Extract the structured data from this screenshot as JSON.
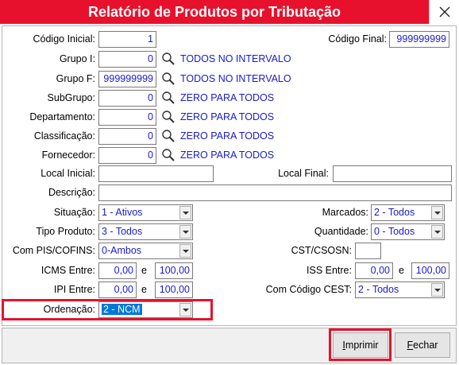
{
  "window": {
    "title": "Relatório de Produtos por Tributação",
    "close_icon": "close-icon"
  },
  "fields": {
    "codigo_inicial": {
      "label": "Código Inicial:",
      "value": "1"
    },
    "codigo_final": {
      "label": "Código Final:",
      "value": "999999999"
    },
    "grupo_i": {
      "label": "Grupo I:",
      "value": "0",
      "hint": "TODOS NO INTERVALO"
    },
    "grupo_f": {
      "label": "Grupo F:",
      "value": "999999999",
      "hint": "TODOS NO INTERVALO"
    },
    "subgrupo": {
      "label": "SubGrupo:",
      "value": "0",
      "hint": "ZERO PARA TODOS"
    },
    "departamento": {
      "label": "Departamento:",
      "value": "0",
      "hint": "ZERO PARA TODOS"
    },
    "classificacao": {
      "label": "Classificação:",
      "value": "0",
      "hint": "ZERO PARA TODOS"
    },
    "fornecedor": {
      "label": "Fornecedor:",
      "value": "0",
      "hint": "ZERO PARA TODOS"
    },
    "local_inicial": {
      "label": "Local Inicial:",
      "value": ""
    },
    "local_final": {
      "label": "Local Final:",
      "value": ""
    },
    "descricao": {
      "label": "Descrição:",
      "value": ""
    },
    "situacao": {
      "label": "Situação:",
      "value": "1 - Ativos"
    },
    "marcados": {
      "label": "Marcados:",
      "value": "2 - Todos"
    },
    "tipo_produto": {
      "label": "Tipo Produto:",
      "value": "3 - Todos"
    },
    "quantidade": {
      "label": "Quantidade:",
      "value": "0 - Todos"
    },
    "pis_cofins": {
      "label": "Com PIS/COFINS:",
      "value": "0-Ambos"
    },
    "cst_csosn": {
      "label": "CST/CSOSN:",
      "value": ""
    },
    "icms_entre": {
      "label": "ICMS Entre:",
      "from": "0,00",
      "sep": "e",
      "to": "100,00"
    },
    "iss_entre": {
      "label": "ISS Entre:",
      "from": "0,00",
      "sep": "e",
      "to": "100,00"
    },
    "ipi_entre": {
      "label": "IPI Entre:",
      "from": "0,00",
      "sep": "e",
      "to": "100,00"
    },
    "codigo_cest": {
      "label": "Com Código CEST:",
      "value": "2 - Todos"
    },
    "ordenacao": {
      "label": "Ordenação:",
      "value": "2 - NCM"
    }
  },
  "buttons": {
    "imprimir": {
      "mnemonic": "I",
      "rest": "mprimir"
    },
    "fechar": {
      "mnemonic": "F",
      "rest": "echar"
    }
  },
  "colors": {
    "title_bar": "#e8112d",
    "value_text": "#1a1ad0",
    "highlight": "#e8112d",
    "selection": "#0078d7"
  },
  "icons": {
    "lookup": "magnifier-icon",
    "dropdown": "chevron-down-icon"
  }
}
